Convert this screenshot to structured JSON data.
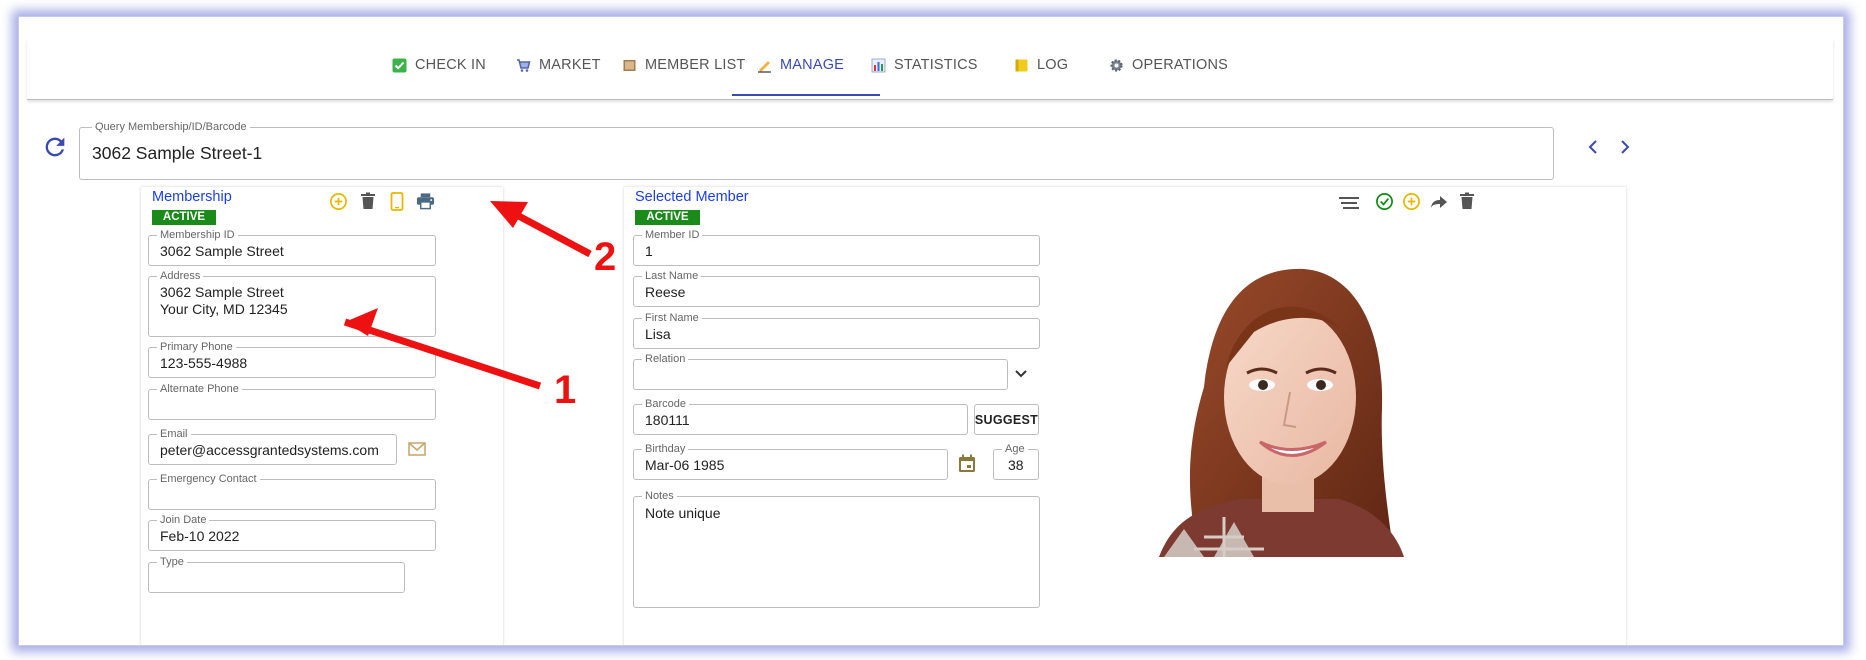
{
  "nav": {
    "tabs": [
      {
        "label": "CHECK IN",
        "icon": "check-box-icon",
        "active": false
      },
      {
        "label": "MARKET",
        "icon": "cart-icon",
        "active": false
      },
      {
        "label": "MEMBER LIST",
        "icon": "book-icon",
        "active": false
      },
      {
        "label": "MANAGE",
        "icon": "writing-hand-icon",
        "active": true
      },
      {
        "label": "STATISTICS",
        "icon": "bar-chart-icon",
        "active": false
      },
      {
        "label": "LOG",
        "icon": "notebook-icon",
        "active": false
      },
      {
        "label": "OPERATIONS",
        "icon": "gear-icon",
        "active": false
      }
    ]
  },
  "query": {
    "label": "Query Membership/ID/Barcode",
    "value": "3062 Sample Street-1"
  },
  "membership": {
    "title": "Membership",
    "status": "ACTIVE",
    "fields": {
      "membership_id": {
        "label": "Membership ID",
        "value": "3062 Sample Street"
      },
      "address": {
        "label": "Address",
        "value": "3062 Sample Street\nYour City, MD 12345"
      },
      "primary_phone": {
        "label": "Primary Phone",
        "value": "123-555-4988"
      },
      "alternate_phone": {
        "label": "Alternate Phone",
        "value": ""
      },
      "email": {
        "label": "Email",
        "value": "peter@accessgrantedsystems.com"
      },
      "emergency_contact": {
        "label": "Emergency Contact",
        "value": ""
      },
      "join_date": {
        "label": "Join Date",
        "value": "Feb-10 2022"
      },
      "type": {
        "label": "Type",
        "value": ""
      }
    }
  },
  "member": {
    "title": "Selected Member",
    "status": "ACTIVE",
    "fields": {
      "member_id": {
        "label": "Member ID",
        "value": "1"
      },
      "last_name": {
        "label": "Last Name",
        "value": "Reese"
      },
      "first_name": {
        "label": "First Name",
        "value": "Lisa"
      },
      "relation": {
        "label": "Relation",
        "value": ""
      },
      "barcode": {
        "label": "Barcode",
        "value": "180111"
      },
      "birthday": {
        "label": "Birthday",
        "value": "Mar-06 1985"
      },
      "age": {
        "label": "Age",
        "value": "38"
      },
      "notes": {
        "label": "Notes",
        "value": "Note unique"
      }
    },
    "suggest_label": "SUGGEST"
  },
  "annotations": {
    "arrow1": "1",
    "arrow2": "2"
  },
  "colors": {
    "accent": "#3a4ab5",
    "title_blue": "#1d3ee6",
    "active_green": "#1a8a1a",
    "icon_yellow": "#e6b800",
    "annotation_red": "#ee1111"
  }
}
